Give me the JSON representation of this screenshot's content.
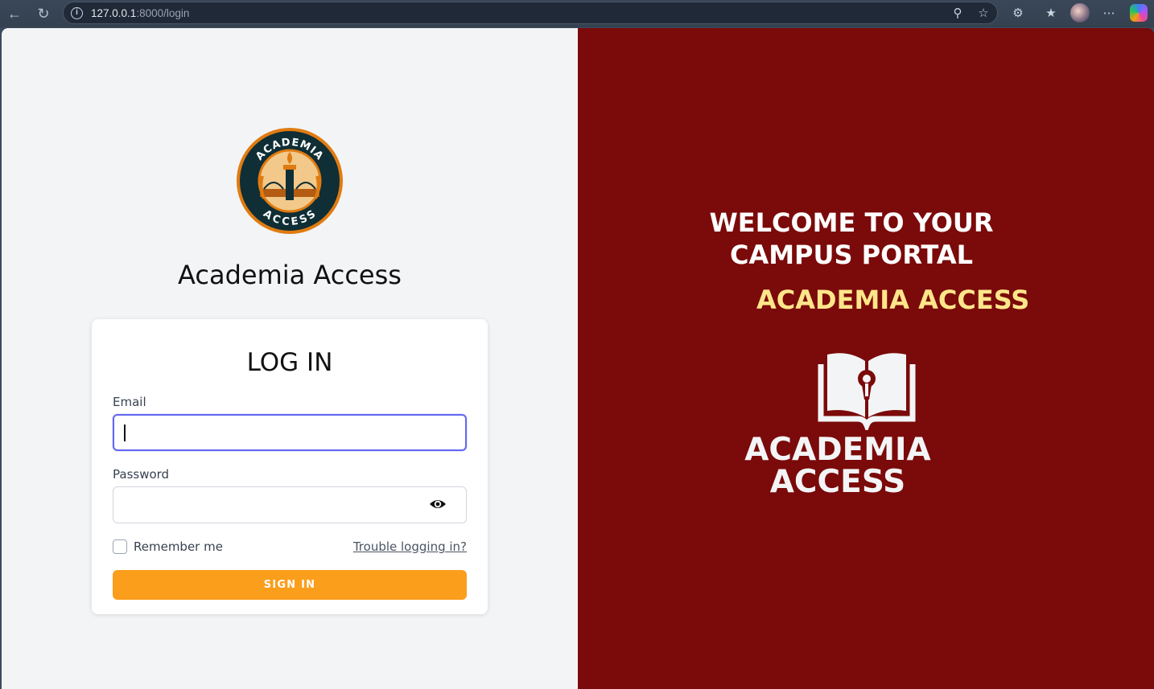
{
  "browser": {
    "url_host": "127.0.0.1",
    "url_path": ":8000/login"
  },
  "left": {
    "app_name": "Academia Access",
    "seal_top_text": "ACADEMIA",
    "seal_bottom_text": "ACCESS",
    "login_title": "LOG IN",
    "email_label": "Email",
    "email_value": "",
    "password_label": "Password",
    "password_value": "",
    "remember_label": "Remember me",
    "remember_checked": false,
    "trouble_link": "Trouble logging in?",
    "signin_label": "SIGN IN"
  },
  "right": {
    "welcome_line1": "WELCOME TO YOUR",
    "welcome_line2": "CAMPUS PORTAL",
    "brand": "ACADEMIA ACCESS",
    "logo_line1": "ACADEMIA",
    "logo_line2": "ACCESS"
  },
  "colors": {
    "panel_red": "#7b0a0a",
    "signin_orange": "#fb9e1b",
    "brand_yellow": "#fde68a",
    "focus_border": "#6366f1"
  }
}
